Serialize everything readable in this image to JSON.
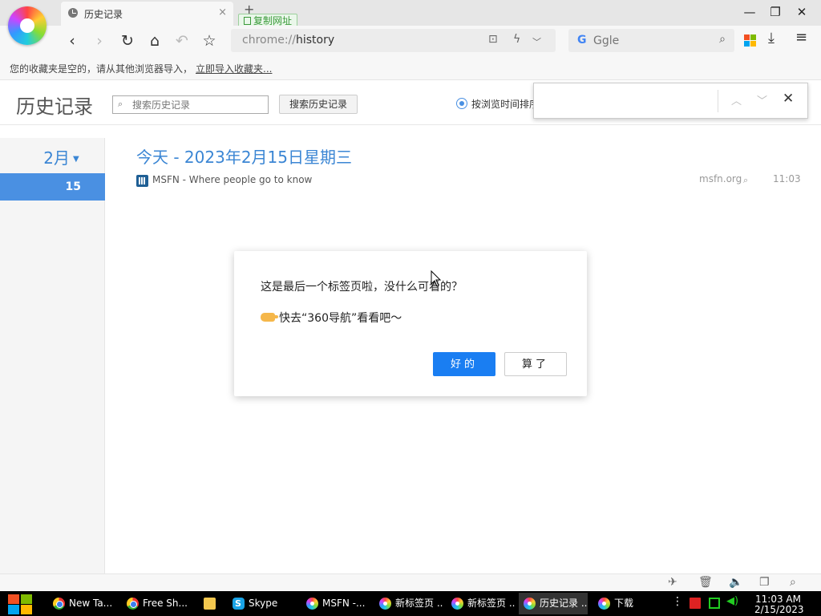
{
  "tab": {
    "title": "历史记录",
    "close": "×",
    "new_tab": "+"
  },
  "copy_url_badge": "复制网址",
  "window": {
    "minimize": "—",
    "restore": "❐",
    "close": "✕"
  },
  "toolbar": {
    "back": "‹",
    "forward": "›",
    "reload": "↻",
    "home": "⌂",
    "undo": "↶",
    "star": "☆",
    "address_scheme": "chrome://",
    "address_path": "history",
    "search_engine_letter": "G",
    "search_placeholder": "Ggle",
    "download": "⤓",
    "menu": "≡"
  },
  "bookmark_bar": {
    "empty_text": "您的收藏夹是空的，请从其他浏览器导入，",
    "import_link": "立即导入收藏夹..."
  },
  "history": {
    "title": "历史记录",
    "search_placeholder": "搜索历史记录",
    "search_button": "搜索历史记录",
    "sort_label": "按浏览时间排序",
    "month": "2月",
    "day": "15",
    "day_heading": "今天 - 2023年2月15日星期三",
    "entries": [
      {
        "title": "MSFN - Where people go to know",
        "domain": "msfn.org",
        "time": "11:03"
      }
    ]
  },
  "findbar": {
    "up": "︿",
    "down": "﹀",
    "close": "✕"
  },
  "dialog": {
    "message": "这是最后一个标签页啦，没什么可看的？",
    "sub_message": "快去“360导航”看看吧～",
    "ok_label": "好的",
    "cancel_label": "算了"
  },
  "taskbar": {
    "items": [
      {
        "label": "New Ta...",
        "icon": "chrome-icon"
      },
      {
        "label": "Free Sh...",
        "icon": "chrome-icon"
      },
      {
        "label": "",
        "icon": "folder-icon"
      },
      {
        "label": "Skype",
        "icon": "skype-icon"
      },
      {
        "label": "MSFN -...",
        "icon": "browser-360-icon"
      },
      {
        "label": "新标签页 ...",
        "icon": "browser-360-icon"
      },
      {
        "label": "新标签页 ...",
        "icon": "browser-360-icon"
      },
      {
        "label": "历史记录 ...",
        "icon": "browser-360-icon"
      },
      {
        "label": "下载",
        "icon": "browser-360-icon"
      }
    ],
    "time": "11:03 AM",
    "date": "2/15/2023"
  },
  "colors": {
    "accent": "#1a7ef2",
    "link_blue": "#3b86d4",
    "selected_day": "#4a90e2"
  }
}
